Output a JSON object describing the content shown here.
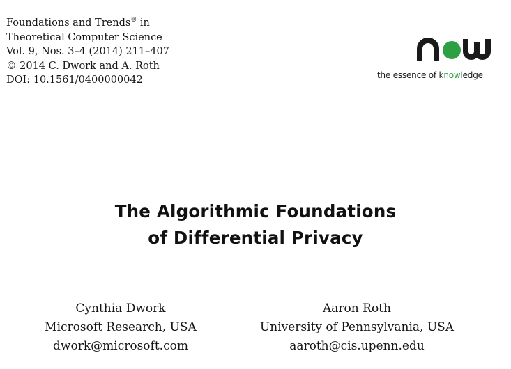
{
  "header": {
    "journal_prefix": "Foundations and Trends",
    "journal_reg": "®",
    "journal_suffix": " in",
    "journal_line2": "Theoretical Computer Science",
    "volume": "Vol. 9, Nos. 3–4 (2014) 211–407",
    "copyright": "© 2014 C. Dwork and A. Roth",
    "doi": "DOI: 10.1561/0400000042"
  },
  "publisher": {
    "logo_name": "now-publishers-logo",
    "tagline_before": "the essence of k",
    "tagline_highlight": "now",
    "tagline_after": "ledge",
    "brand_color": "#2ea043"
  },
  "title": {
    "line1": "The Algorithmic Foundations",
    "line2": "of Differential Privacy"
  },
  "authors": [
    {
      "name": "Cynthia Dwork",
      "affiliation": "Microsoft Research, USA",
      "email": "dwork@microsoft.com"
    },
    {
      "name": "Aaron Roth",
      "affiliation": "University of Pennsylvania, USA",
      "email": "aaroth@cis.upenn.edu"
    }
  ]
}
